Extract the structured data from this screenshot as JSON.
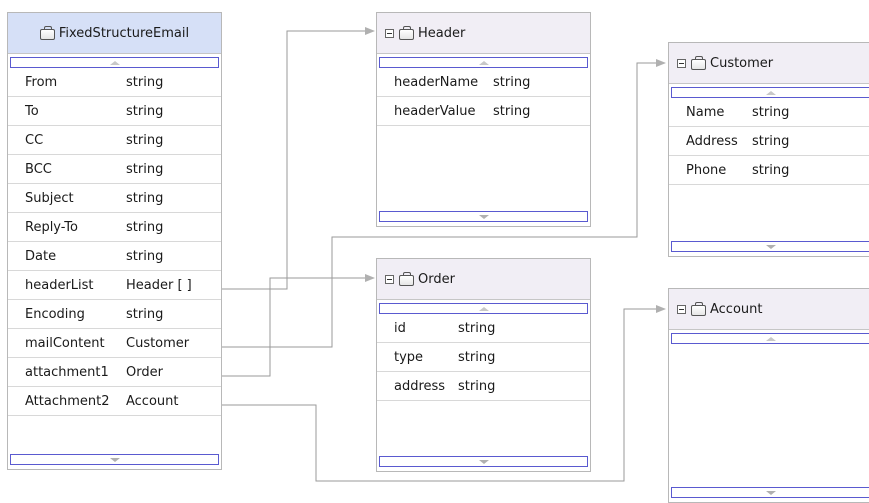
{
  "main": {
    "title": "FixedStructureEmail",
    "fields": [
      {
        "name": "From",
        "type": "string"
      },
      {
        "name": "To",
        "type": "string"
      },
      {
        "name": "CC",
        "type": "string"
      },
      {
        "name": "BCC",
        "type": "string"
      },
      {
        "name": "Subject",
        "type": "string"
      },
      {
        "name": "Reply-To",
        "type": "string"
      },
      {
        "name": "Date",
        "type": "string"
      },
      {
        "name": "headerList",
        "type": "Header [ ]"
      },
      {
        "name": "Encoding",
        "type": "string"
      },
      {
        "name": "mailContent",
        "type": "Customer"
      },
      {
        "name": "attachment1",
        "type": "Order"
      },
      {
        "name": "Attachment2",
        "type": "Account"
      }
    ]
  },
  "header": {
    "title": "Header",
    "fields": [
      {
        "name": "headerName",
        "type": "string"
      },
      {
        "name": "headerValue",
        "type": "string"
      }
    ]
  },
  "customer": {
    "title": "Customer",
    "fields": [
      {
        "name": "Name",
        "type": "string"
      },
      {
        "name": "Address",
        "type": "string"
      },
      {
        "name": "Phone",
        "type": "string"
      }
    ]
  },
  "order": {
    "title": "Order",
    "fields": [
      {
        "name": "id",
        "type": "string"
      },
      {
        "name": "type",
        "type": "string"
      },
      {
        "name": "address",
        "type": "string"
      }
    ]
  },
  "account": {
    "title": "Account",
    "fields": []
  },
  "colors": {
    "main_header_bg": "#d6e0f7",
    "box_header_bg": "#f1eef5",
    "scroll_border": "#5a5ad0",
    "connector": "#9a9a9a"
  }
}
